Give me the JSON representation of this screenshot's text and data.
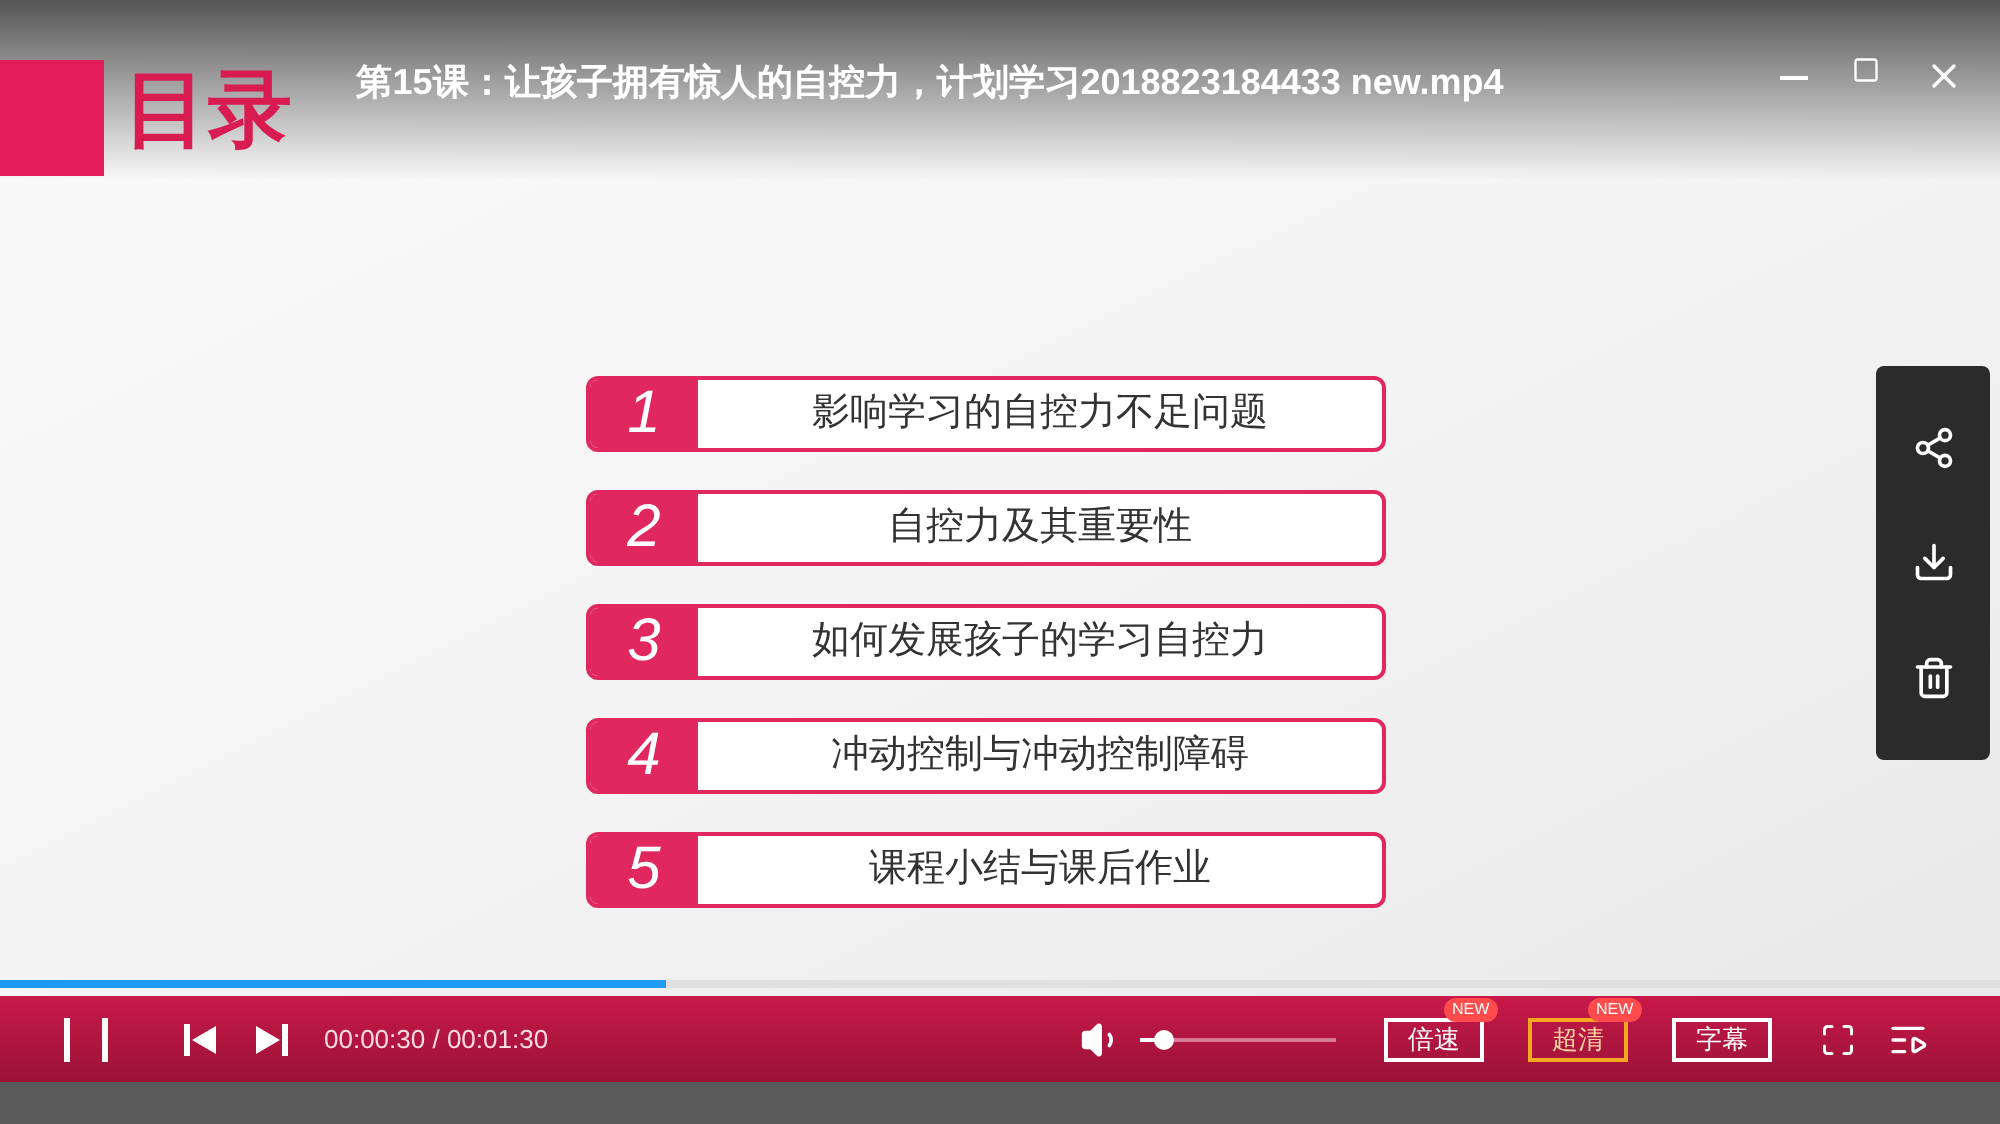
{
  "window": {
    "title": "第15课：让孩子拥有惊人的自控力，计划学习2018823184433 new.mp4"
  },
  "slide": {
    "heading": "目录",
    "items": [
      {
        "number": "1",
        "text": "影响学习的自控力不足问题"
      },
      {
        "number": "2",
        "text": "自控力及其重要性"
      },
      {
        "number": "3",
        "text": "如何发展孩子的学习自控力"
      },
      {
        "number": "4",
        "text": "冲动控制与冲动控制障碍"
      },
      {
        "number": "5",
        "text": "课程小结与课后作业"
      }
    ]
  },
  "player": {
    "progress": {
      "level": 0.333
    },
    "playing": true,
    "time": "00:00:30 / 00:01:30",
    "volume": {
      "level": 0.12
    },
    "buttons": [
      {
        "label": "倍速",
        "badge": "NEW",
        "highlighted": false
      },
      {
        "label": "超清",
        "badge": "NEW",
        "highlighted": true
      },
      {
        "label": "字幕",
        "highlighted": false
      }
    ]
  }
}
